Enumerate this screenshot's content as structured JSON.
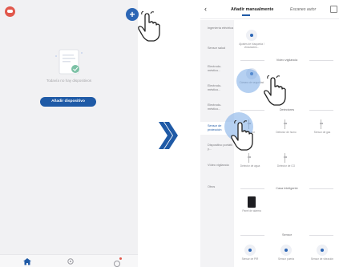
{
  "left_screen": {
    "empty_message": "Todavía no hay dispositivos",
    "add_device_button": "Añadir dispositivo"
  },
  "right_screen": {
    "title": "Añadir manualmente",
    "scan_tab": "Escaneo autor",
    "sidebar": [
      "Ingeniería eléctrica",
      "Sensor salud",
      "Electrodo-méstico...",
      "Electrodo-méstico...",
      "Electrodo-méstico...",
      "Sensor de protección",
      "Dispositivo portátil y...",
      "Vídeo vigilancia",
      "Otros"
    ],
    "top_item": "Ajustes de búsqueda / vinculación...",
    "sections": {
      "video": "Vídeo vigilancia",
      "detectors": "Detectores",
      "smart_home": "Casa Inteligente",
      "sensor": "Sensor"
    },
    "video_item": "Cámara de seguridad",
    "detectors_items": [
      "Detector",
      "Detector de humo",
      "Sensor de gas",
      "Detector de agua",
      "Detector de CO"
    ],
    "smart_home_item": "Panel de alarma",
    "sensor_items": [
      "Sensor de PIR",
      "Sensor puerta",
      "Sensor de vibración"
    ]
  },
  "colors": {
    "accent": "#1f5aa6",
    "avatar": "#e1584c"
  }
}
